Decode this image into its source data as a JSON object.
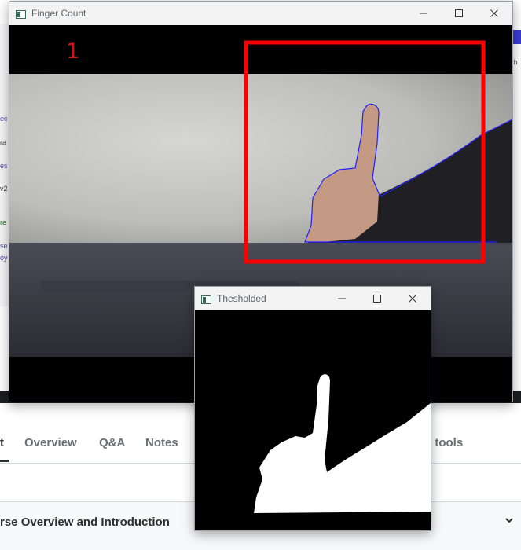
{
  "finger_window": {
    "title": "Finger Count",
    "finger_count": "1",
    "icon": "window-app-icon"
  },
  "threshold_window": {
    "title": "Thesholded",
    "icon": "window-app-icon"
  },
  "window_controls": {
    "minimize_icon": "minimize-icon",
    "maximize_icon": "maximize-icon",
    "close_icon": "close-icon"
  },
  "background_page": {
    "tabs": [
      {
        "label": "t",
        "active": true
      },
      {
        "label": "Overview",
        "active": false
      },
      {
        "label": "Q&A",
        "active": false
      },
      {
        "label": "Notes",
        "active": false
      },
      {
        "label": "g tools",
        "active": false
      }
    ],
    "section_title": "rse Overview and Introduction",
    "left_fragments": [
      "ec",
      "ra",
      "es",
      "v2",
      "re",
      "se",
      "oy"
    ],
    "right_fragments": [
      "th"
    ],
    "chevron_icon": "chevron-down-icon"
  },
  "colors": {
    "roi_box": "#ff0000",
    "contour": "#2020ff",
    "count_text": "#e01010",
    "mask_foreground": "#ffffff",
    "mask_background": "#000000"
  }
}
